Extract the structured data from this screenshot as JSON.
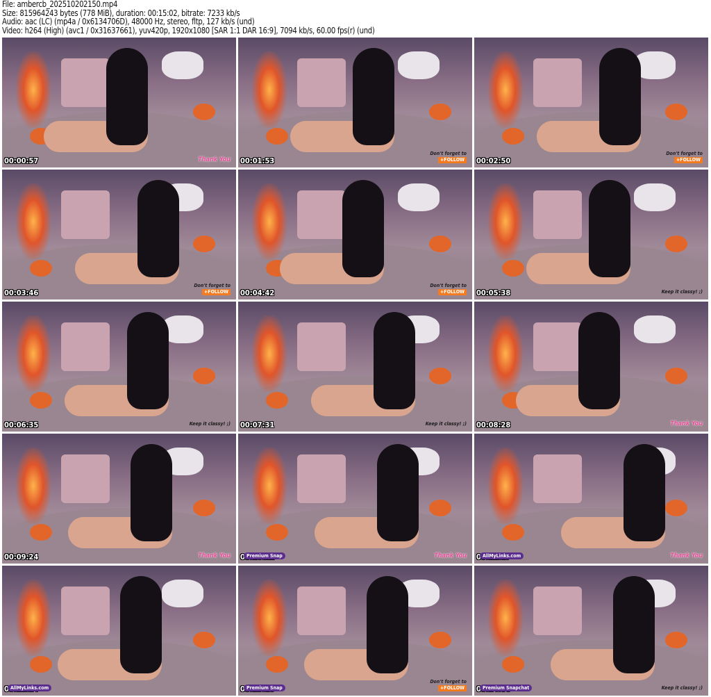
{
  "header": {
    "file": "File: ambercb_202510202150.mp4",
    "size": "Size: 815964243 bytes (778 MiB), duration: 00:15:02, bitrate: 7233 kb/s",
    "audio": "Audio: aac (LC) (mp4a / 0x6134706D), 48000 Hz, stereo, fltp, 127 kb/s (und)",
    "video": "Video: h264 (High) (avc1 / 0x31637661), yuv420p, 1920x1080 [SAR 1:1 DAR 16:9], 7094 kb/s, 60.00 fps(r) (und)"
  },
  "thumbnails": [
    {
      "time": "00:00:57",
      "overlay": "Thank You",
      "type": "thank",
      "left": ""
    },
    {
      "time": "00:01:53",
      "overlay": "Don't forget to",
      "follow": "+FOLLOW",
      "type": "follow",
      "left": ""
    },
    {
      "time": "00:02:50",
      "overlay": "Don't forget to",
      "follow": "+FOLLOW",
      "type": "follow",
      "left": ""
    },
    {
      "time": "00:03:46",
      "overlay": "Don't forget to",
      "follow": "+FOLLOW",
      "type": "follow",
      "left": ""
    },
    {
      "time": "00:04:42",
      "overlay": "Don't forget to",
      "follow": "+FOLLOW",
      "type": "follow",
      "left": ""
    },
    {
      "time": "00:05:38",
      "overlay": "Keep it classy! ;)",
      "type": "classy",
      "left": ""
    },
    {
      "time": "00:06:35",
      "overlay": "Keep it classy! ;)",
      "type": "classy",
      "left": ""
    },
    {
      "time": "00:07:31",
      "overlay": "Keep it classy! ;)",
      "type": "classy",
      "left": ""
    },
    {
      "time": "00:08:28",
      "overlay": "Thank You",
      "type": "thank",
      "left": ""
    },
    {
      "time": "00:09:24",
      "overlay": "Thank You",
      "type": "thank",
      "left": ""
    },
    {
      "time": "00:10:21",
      "overlay": "Thank You",
      "type": "thank",
      "left": "Premium Snap"
    },
    {
      "time": "00:11:17",
      "overlay": "Thank You",
      "type": "thank",
      "left": "AllMyLinks.com"
    },
    {
      "time": "00:12:14",
      "overlay": "",
      "type": "none",
      "left": "AllMyLinks.com"
    },
    {
      "time": "00:13:10",
      "overlay": "Don't forget to",
      "follow": "+FOLLOW",
      "type": "follow",
      "left": "Premium Snap"
    },
    {
      "time": "00:14:06",
      "overlay": "Keep it classy! ;)",
      "type": "classy",
      "left": "Premium Snapchat"
    }
  ]
}
